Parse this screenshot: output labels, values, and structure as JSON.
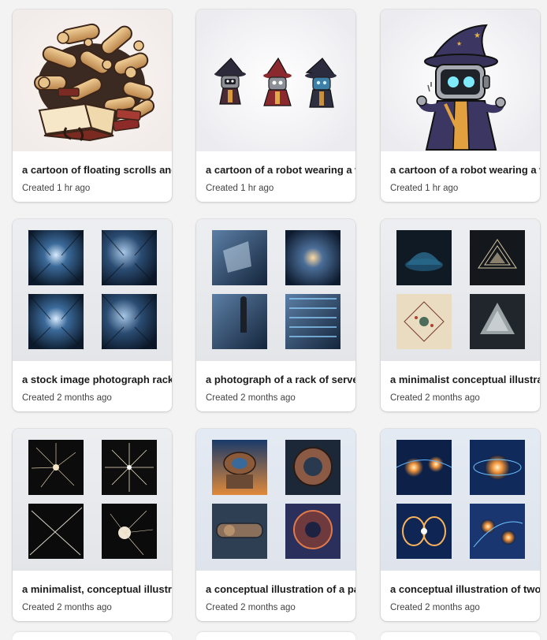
{
  "cards": [
    {
      "title": "a cartoon of floating scrolls and books",
      "meta": "Created 1 hr ago",
      "art": "scrolls-books-illustration"
    },
    {
      "title": "a cartoon of a robot wearing a wizard hat",
      "meta": "Created 1 hr ago",
      "art": "three-robot-wizards-illustration"
    },
    {
      "title": "a cartoon of a robot wearing a wizard hat",
      "meta": "Created 1 hr ago",
      "art": "robot-wizard-illustration"
    },
    {
      "title": "a stock image photograph rack of servers",
      "meta": "Created 2 months ago",
      "art": "server-room-collage"
    },
    {
      "title": "a photograph of a rack of servers",
      "meta": "Created 2 months ago",
      "art": "server-rack-collage"
    },
    {
      "title": "a minimalist conceptual illustration",
      "meta": "Created 2 months ago",
      "art": "network-pyramid-collage"
    },
    {
      "title": "a minimalist, conceptual illustration",
      "meta": "Created 2 months ago",
      "art": "starburst-collage"
    },
    {
      "title": "a conceptual illustration of a particle accelerator",
      "meta": "Created 2 months ago",
      "art": "particle-accelerator-collage"
    },
    {
      "title": "a conceptual illustration of two particles",
      "meta": "Created 2 months ago",
      "art": "particle-collision-collage"
    }
  ]
}
